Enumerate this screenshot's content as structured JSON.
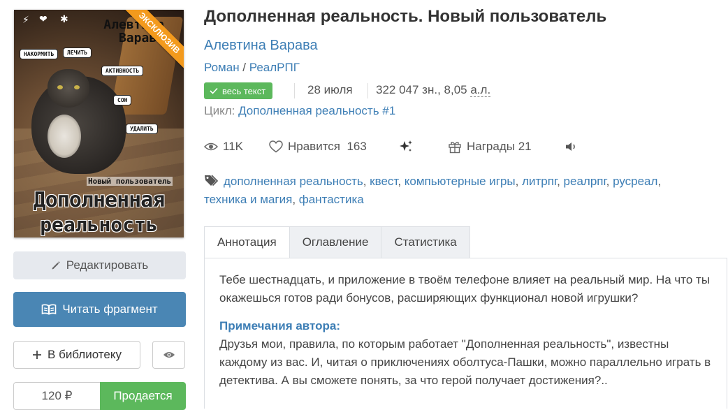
{
  "cover": {
    "author_text": "Алевтина Варава",
    "ribbon": "ЭКСКЛЮЗИВ",
    "subtitle": "Новый пользователь",
    "title_line1": "Дополненная",
    "title_line2": "реальность",
    "bubbles": [
      "НАКОРМИТЬ",
      "ЛЕЧИТЬ",
      "АКТИВНОСТЬ",
      "СОН",
      "УДАЛИТЬ"
    ]
  },
  "buttons": {
    "edit": "Редактировать",
    "read": "Читать фрагмент",
    "library": "В библиотеку",
    "price": "120 ₽",
    "sale": "Продается"
  },
  "book": {
    "title": "Дополненная реальность. Новый пользователь",
    "author": "Алевтина Варава",
    "genre1": "Роман",
    "genre_sep": " / ",
    "genre2": "РеалРПГ",
    "badge": "весь текст",
    "date": "28 июля",
    "size_prefix": "322 047 зн., 8,05 ",
    "size_unit": "а.л.",
    "cycle_label": "Цикл: ",
    "cycle_name": "Дополненная реальность #1"
  },
  "stats": {
    "views": "11K",
    "likes_label": "Нравится",
    "likes_count": "163",
    "awards_label": "Награды",
    "awards_count": "21"
  },
  "tags": [
    "дополненная реальность",
    "квест",
    "компьютерные игры",
    "литрпг",
    "реалрпг",
    "русреал",
    "техника и магия",
    "фантастика"
  ],
  "tabs": [
    "Аннотация",
    "Оглавление",
    "Статистика"
  ],
  "annotation": {
    "text": "Тебе шестнадцать, и приложение в твоём телефоне влияет на реальный мир. На что ты окажешься готов ради бонусов, расширяющих функционал новой игрушки?",
    "note_title": "Примечания автора:",
    "note_text": "Друзья мои, правила, по которым работает \"Дополненная реальность\", известны каждому из вас. И, читая о приключениях оболтуса-Пашки, можно параллельно играть в детектива. А вы сможете понять, за что герой получает достижения?.."
  },
  "colors": {
    "link": "#3d7eb5",
    "primary_button": "#4a86b4",
    "success": "#5cb85c",
    "ribbon": "#f39a1d"
  }
}
